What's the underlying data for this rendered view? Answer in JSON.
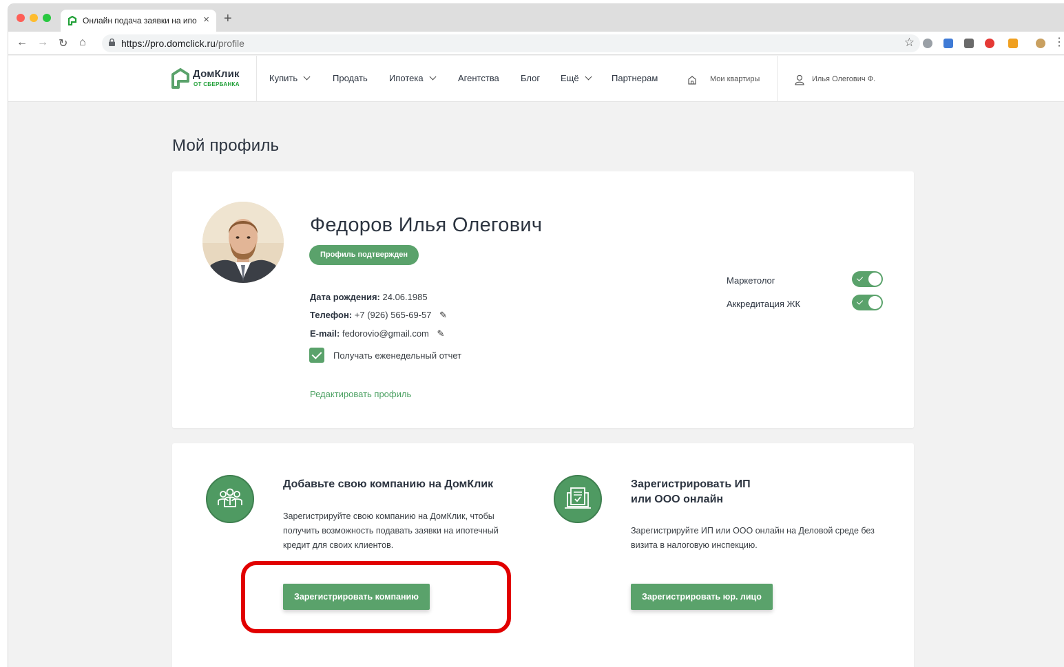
{
  "browser": {
    "tab_title": "Онлайн подача заявки на ипо",
    "url_host": "https://pro.domclick.ru",
    "url_path": "/profile",
    "new_tab_symbol": "+",
    "close_symbol": "×"
  },
  "site": {
    "logo_main": "ДомКлик",
    "logo_sub": "ОТ СБЕРБАНКА",
    "menu": [
      "Купить",
      "Продать",
      "Ипотека",
      "Агентства",
      "Блог",
      "Ещё",
      "Партнерам"
    ],
    "my_apartments": "Мои квартиры",
    "user_short": "Илья Олегович Ф."
  },
  "page": {
    "title": "Мой профиль"
  },
  "profile": {
    "full_name": "Федоров Илья Олегович",
    "badge": "Профиль подтвержден",
    "birth_label": "Дата рождения:",
    "birth_value": "24.06.1985",
    "phone_label": "Телефон:",
    "phone_value": "+7 (926) 565-69-57",
    "email_label": "E-mail:",
    "email_value": "fedorovio@gmail.com",
    "weekly_report_label": "Получать еженедельный отчет",
    "weekly_report_checked": true,
    "edit_link": "Редактировать профиль",
    "toggles": [
      {
        "label": "Маркетолог",
        "on": true
      },
      {
        "label": "Аккредитация ЖК",
        "on": true
      }
    ]
  },
  "company_block": {
    "title": "Добавьте свою компанию на ДомКлик",
    "text": "Зарегистрируйте свою компанию на ДомКлик, чтобы получить возможность подавать заявки на ипотечный кредит для своих клиентов.",
    "button": "Зарегистрировать компанию"
  },
  "ip_block": {
    "title_line1": "Зарегистрировать ИП",
    "title_line2": "или ООО онлайн",
    "text": "Зарегистрируйте ИП или ООО онлайн на Деловой среде без визита в налоговую инспекцию.",
    "button": "Зарегистрировать юр. лицо"
  },
  "colors": {
    "accent_green": "#5aa26b",
    "highlight_red": "#e10000"
  }
}
